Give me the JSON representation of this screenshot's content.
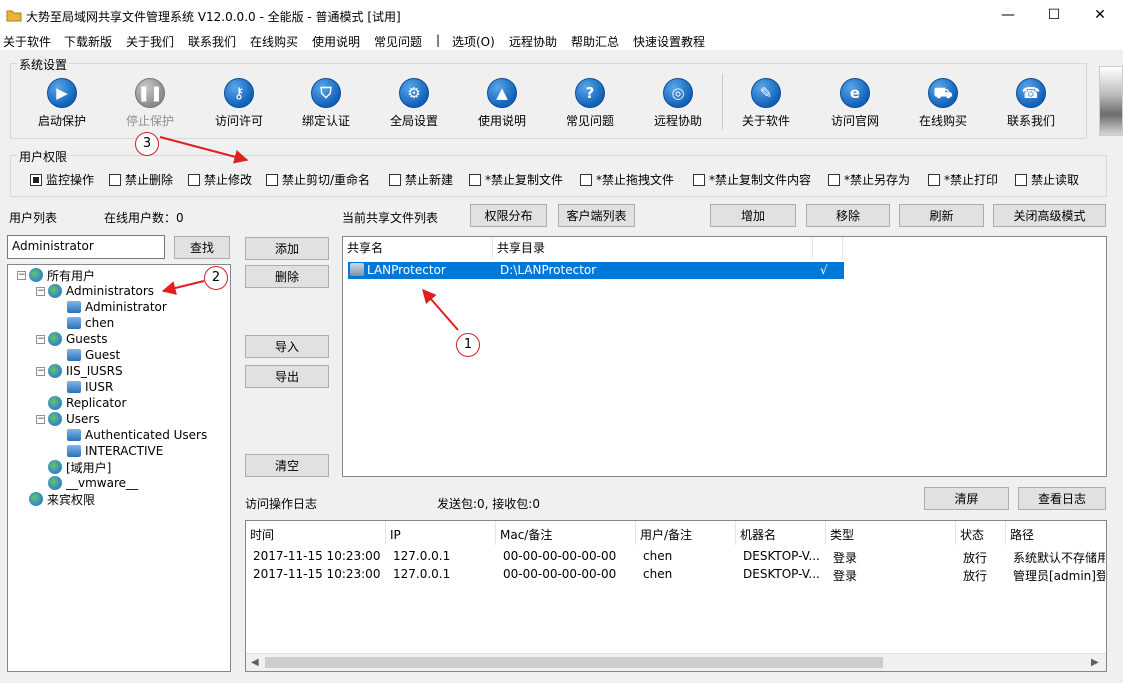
{
  "window": {
    "title": "大势至局域网共享文件管理系统 V12.0.0.0 - 全能版 - 普通模式 [试用]",
    "minimize": "—",
    "maximize": "☐",
    "close": "✕"
  },
  "menu": [
    "关于软件",
    "下载新版",
    "关于我们",
    "联系我们",
    "在线购买",
    "使用说明",
    "常见问题",
    "|",
    "选项(O)",
    "远程协助",
    "帮助汇总",
    "快速设置教程"
  ],
  "toolbar": {
    "group_title": "系统设置",
    "buttons": [
      {
        "label": "启动保护",
        "icon": "play-icon"
      },
      {
        "label": "停止保护",
        "icon": "pause-icon"
      },
      {
        "label": "访问许可",
        "icon": "key-icon"
      },
      {
        "label": "绑定认证",
        "icon": "shield-icon"
      },
      {
        "label": "全局设置",
        "icon": "gear-icon"
      },
      {
        "label": "使用说明",
        "icon": "graduation-cap-icon"
      },
      {
        "label": "常见问题",
        "icon": "question-icon"
      },
      {
        "label": "远程协助",
        "icon": "network-icon"
      },
      {
        "label": "关于软件",
        "icon": "document-icon"
      },
      {
        "label": "访问官网",
        "icon": "ie-icon"
      },
      {
        "label": "在线购买",
        "icon": "cart-icon"
      },
      {
        "label": "联系我们",
        "icon": "phone-icon"
      }
    ]
  },
  "permissions": {
    "group_title": "用户权限",
    "items": [
      {
        "label": "监控操作",
        "checked": true
      },
      {
        "label": "禁止删除",
        "checked": false
      },
      {
        "label": "禁止修改",
        "checked": false
      },
      {
        "label": "禁止剪切/重命名",
        "checked": false
      },
      {
        "label": "禁止新建",
        "checked": false
      },
      {
        "label": "*禁止复制文件",
        "checked": false
      },
      {
        "label": "*禁止拖拽文件",
        "checked": false
      },
      {
        "label": "*禁止复制文件内容",
        "checked": false
      },
      {
        "label": "*禁止另存为",
        "checked": false
      },
      {
        "label": "*禁止打印",
        "checked": false
      },
      {
        "label": "禁止读取",
        "checked": false
      }
    ]
  },
  "users": {
    "list_label": "用户列表",
    "online_label": "在线用户数：0",
    "search_value": "Administrator",
    "search_button": "查找",
    "tree": [
      {
        "label": "所有用户",
        "kind": "group",
        "level": 0,
        "expanded": true
      },
      {
        "label": "Administrators",
        "kind": "group",
        "level": 1,
        "expanded": true
      },
      {
        "label": "Administrator",
        "kind": "user",
        "level": 2
      },
      {
        "label": "chen",
        "kind": "user",
        "level": 2
      },
      {
        "label": "Guests",
        "kind": "group",
        "level": 1,
        "expanded": true
      },
      {
        "label": "Guest",
        "kind": "user",
        "level": 2
      },
      {
        "label": "IIS_IUSRS",
        "kind": "group",
        "level": 1,
        "expanded": true
      },
      {
        "label": "IUSR",
        "kind": "user",
        "level": 2
      },
      {
        "label": "Replicator",
        "kind": "group",
        "level": 1,
        "expanded": false
      },
      {
        "label": "Users",
        "kind": "group",
        "level": 1,
        "expanded": true
      },
      {
        "label": "Authenticated Users",
        "kind": "user",
        "level": 2
      },
      {
        "label": "INTERACTIVE",
        "kind": "user",
        "level": 2
      },
      {
        "label": "[域用户]",
        "kind": "group",
        "level": 1,
        "expanded": false
      },
      {
        "label": "__vmware__",
        "kind": "group",
        "level": 1,
        "expanded": false
      },
      {
        "label": "来宾权限",
        "kind": "group",
        "level": 0,
        "expanded": false
      }
    ]
  },
  "actions": {
    "add": "添加",
    "delete": "删除",
    "import": "导入",
    "export": "导出",
    "clear": "清空"
  },
  "shares": {
    "label": "当前共享文件列表",
    "perm_dist_button": "权限分布",
    "client_list_button": "客户端列表",
    "add_button": "增加",
    "remove_button": "移除",
    "refresh_button": "刷新",
    "close_advanced_button": "关闭高级模式",
    "columns": [
      "共享名",
      "共享目录",
      ""
    ],
    "rows": [
      {
        "name": "LANProtector",
        "path": "D:\\LANProtector",
        "flag": "√"
      }
    ]
  },
  "log": {
    "label": "访问操作日志",
    "stats": "发送包:0, 接收包:0",
    "clear_button": "清屏",
    "view_button": "查看日志",
    "columns": [
      "时间",
      "IP",
      "Mac/备注",
      "用户/备注",
      "机器名",
      "类型",
      "状态",
      "路径"
    ],
    "rows": [
      [
        "2017-11-15 10:23:00",
        "127.0.0.1",
        "00-00-00-00-00-00",
        "chen",
        "DESKTOP-V...",
        "登录",
        "放行",
        "系统默认不存储用"
      ],
      [
        "2017-11-15 10:23:00",
        "127.0.0.1",
        "00-00-00-00-00-00",
        "chen",
        "DESKTOP-V...",
        "登录",
        "放行",
        "管理员[admin]登"
      ]
    ]
  },
  "annotations": [
    "1",
    "2",
    "3"
  ],
  "colors": {
    "accent": "#0078d7",
    "annotation": "#e02020",
    "selection": "#0078d7"
  }
}
